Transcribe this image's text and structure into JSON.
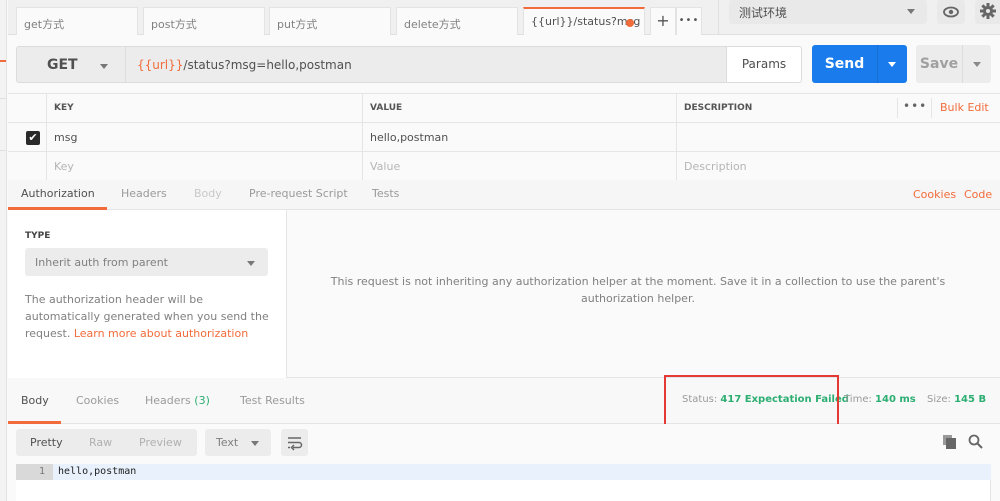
{
  "request_tabs": [
    {
      "label": "get方式",
      "active": false
    },
    {
      "label": "post方式",
      "active": false
    },
    {
      "label": "put方式",
      "active": false
    },
    {
      "label": "delete方式",
      "active": false
    },
    {
      "label": "{{url}}/status?msg",
      "active": true,
      "unsaved": true
    }
  ],
  "tab_actions": {
    "new_tab": "+",
    "more": "•••"
  },
  "environment": {
    "selected": "测试环境"
  },
  "request": {
    "method": "GET",
    "url_variable": "{{url}}",
    "url_path": "/status?msg=hello,postman",
    "params_label": "Params",
    "send_label": "Send",
    "save_label": "Save"
  },
  "params_table": {
    "headers": {
      "key": "KEY",
      "value": "VALUE",
      "description": "DESCRIPTION"
    },
    "more": "•••",
    "bulk_edit": "Bulk Edit",
    "rows": [
      {
        "checked": true,
        "key": "msg",
        "value": "hello,postman",
        "description": ""
      }
    ],
    "placeholders": {
      "key": "Key",
      "value": "Value",
      "description": "Description"
    }
  },
  "request_sub_tabs": [
    {
      "label": "Authorization",
      "state": "active"
    },
    {
      "label": "Headers",
      "state": "normal"
    },
    {
      "label": "Body",
      "state": "disabled"
    },
    {
      "label": "Pre-request Script",
      "state": "normal"
    },
    {
      "label": "Tests",
      "state": "normal"
    }
  ],
  "request_links": {
    "cookies": "Cookies",
    "code": "Code"
  },
  "authorization": {
    "type_label": "TYPE",
    "type_selected": "Inherit auth from parent",
    "help_text": "The authorization header will be automatically generated when you send the request.",
    "help_link": "Learn more about authorization",
    "message": "This request is not inheriting any authorization helper at the moment. Save it in a collection to use the parent's authorization helper."
  },
  "response_tabs": [
    {
      "label": "Body",
      "active": true
    },
    {
      "label": "Cookies",
      "active": false
    },
    {
      "label": "Headers",
      "count": "(3)",
      "active": false
    },
    {
      "label": "Test Results",
      "active": false
    }
  ],
  "response_meta": {
    "status_label": "Status:",
    "status_value": "417 Expectation Failed",
    "time_label": "Time:",
    "time_value": "140 ms",
    "size_label": "Size:",
    "size_value": "145 B"
  },
  "response_view": {
    "modes": [
      "Pretty",
      "Raw",
      "Preview"
    ],
    "active_mode": "Pretty",
    "format": "Text"
  },
  "response_body": [
    {
      "line": "1",
      "text": "hello,postman"
    }
  ],
  "colors": {
    "accent": "#f26b3a",
    "send_blue": "#1a7cec",
    "status_green": "#2dae72",
    "highlight_red": "#e53935"
  }
}
